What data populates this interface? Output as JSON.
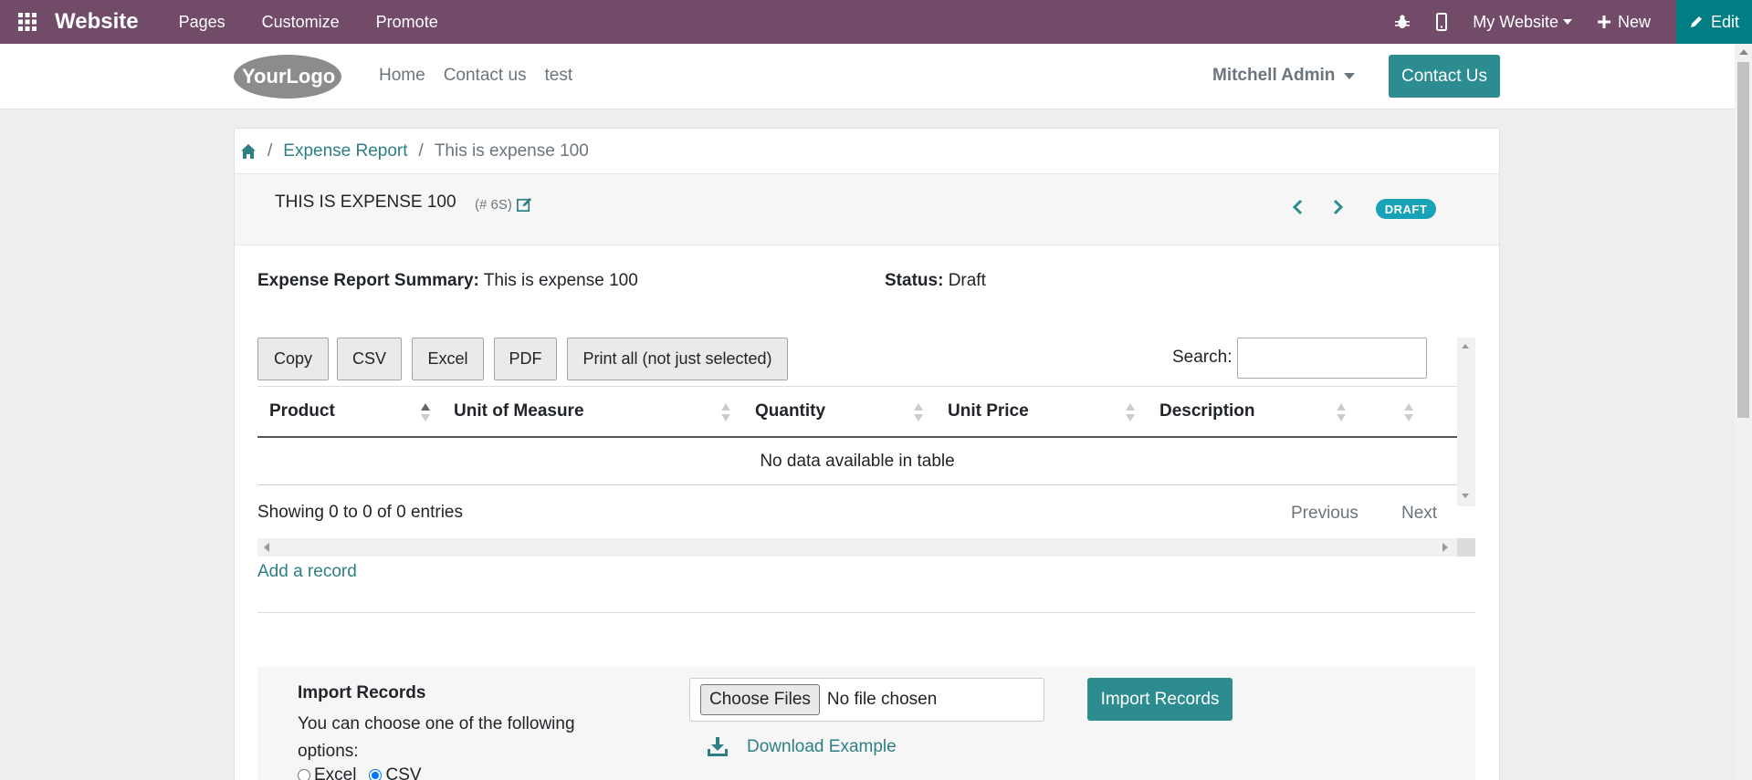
{
  "topbar": {
    "brand": "Website",
    "menu": [
      "Pages",
      "Customize",
      "Promote"
    ],
    "website_selector": "My Website",
    "new_label": "New",
    "edit_label": "Edit",
    "bg_color": "#714b67",
    "edit_color": "#017e84"
  },
  "site_header": {
    "logo_text": "YourLogo",
    "nav": [
      "Home",
      "Contact us",
      "test"
    ],
    "user": "Mitchell Admin",
    "contact_button": "Contact Us"
  },
  "breadcrumb": {
    "items": [
      "Expense Report",
      "This is expense 100"
    ]
  },
  "record": {
    "title": "THIS IS EXPENSE 100",
    "ref": "(# 6S)",
    "status_badge": "DRAFT",
    "summary_label": "Expense Report Summary:",
    "summary_value": "This is expense 100",
    "status_label": "Status:",
    "status_value": "Draft"
  },
  "datatable": {
    "buttons": [
      "Copy",
      "CSV",
      "Excel",
      "PDF",
      "Print all (not just selected)"
    ],
    "search_label": "Search:",
    "search_value": "",
    "columns": [
      "Product",
      "Unit of Measure",
      "Quantity",
      "Unit Price",
      "Description"
    ],
    "empty_message": "No data available in table",
    "info": "Showing 0 to 0 of 0 entries",
    "previous": "Previous",
    "next": "Next"
  },
  "add_record": "Add a record",
  "import": {
    "title": "Import Records",
    "description": "You can choose one of the following options:",
    "options": [
      "Excel",
      "CSV"
    ],
    "selected_option": "CSV",
    "choose_files": "Choose Files",
    "no_file": "No file chosen",
    "import_button": "Import Records",
    "download_example": "Download Example"
  }
}
